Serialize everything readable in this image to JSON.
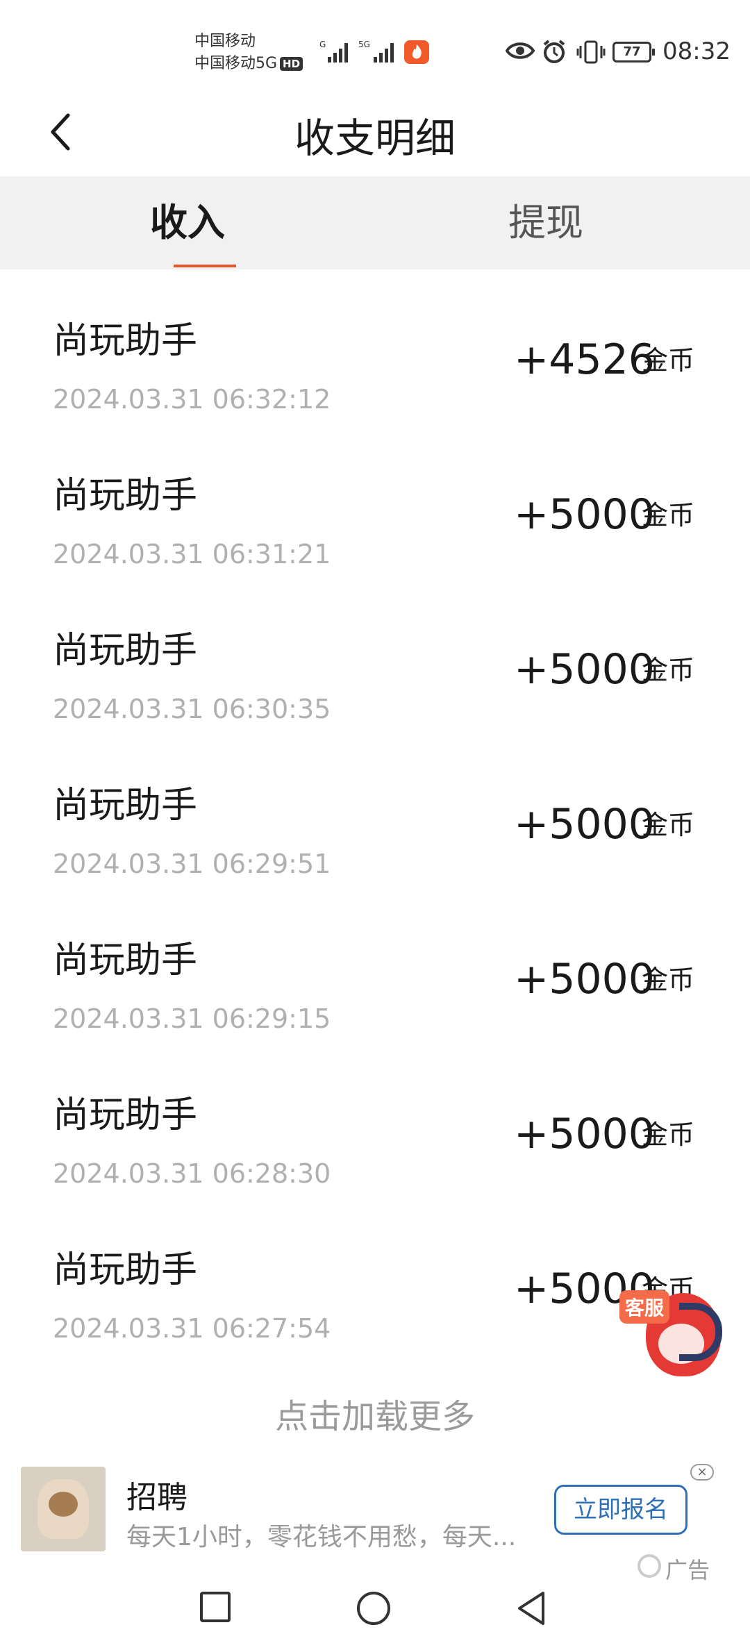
{
  "status_bar": {
    "carrier_1": "中国移动",
    "carrier_2": "中国移动5G",
    "hd_badge": "HD",
    "signal_1_label": "G",
    "signal_2_label": "5G",
    "battery": "77",
    "time": "08:32"
  },
  "header": {
    "title": "收支明细"
  },
  "tabs": {
    "income": "收入",
    "withdraw": "提现"
  },
  "transactions": [
    {
      "title": "尚玩助手",
      "time": "2024.03.31 06:32:12",
      "amount": "+4526",
      "unit": "金币"
    },
    {
      "title": "尚玩助手",
      "time": "2024.03.31 06:31:21",
      "amount": "+5000",
      "unit": "金币"
    },
    {
      "title": "尚玩助手",
      "time": "2024.03.31 06:30:35",
      "amount": "+5000",
      "unit": "金币"
    },
    {
      "title": "尚玩助手",
      "time": "2024.03.31 06:29:51",
      "amount": "+5000",
      "unit": "金币"
    },
    {
      "title": "尚玩助手",
      "time": "2024.03.31 06:29:15",
      "amount": "+5000",
      "unit": "金币"
    },
    {
      "title": "尚玩助手",
      "time": "2024.03.31 06:28:30",
      "amount": "+5000",
      "unit": "金币"
    },
    {
      "title": "尚玩助手",
      "time": "2024.03.31 06:27:54",
      "amount": "+5000",
      "unit": "金币"
    }
  ],
  "load_more": "点击加载更多",
  "support": {
    "badge": "客服"
  },
  "ad": {
    "title": "招聘",
    "description": "每天1小时，零花钱不用愁，每天...",
    "cta": "立即报名",
    "close": "×",
    "label": "广告"
  },
  "colors": {
    "accent": "#e5552e",
    "tab_bg": "#f1f1f1",
    "cta_blue": "#2f6fb8"
  }
}
